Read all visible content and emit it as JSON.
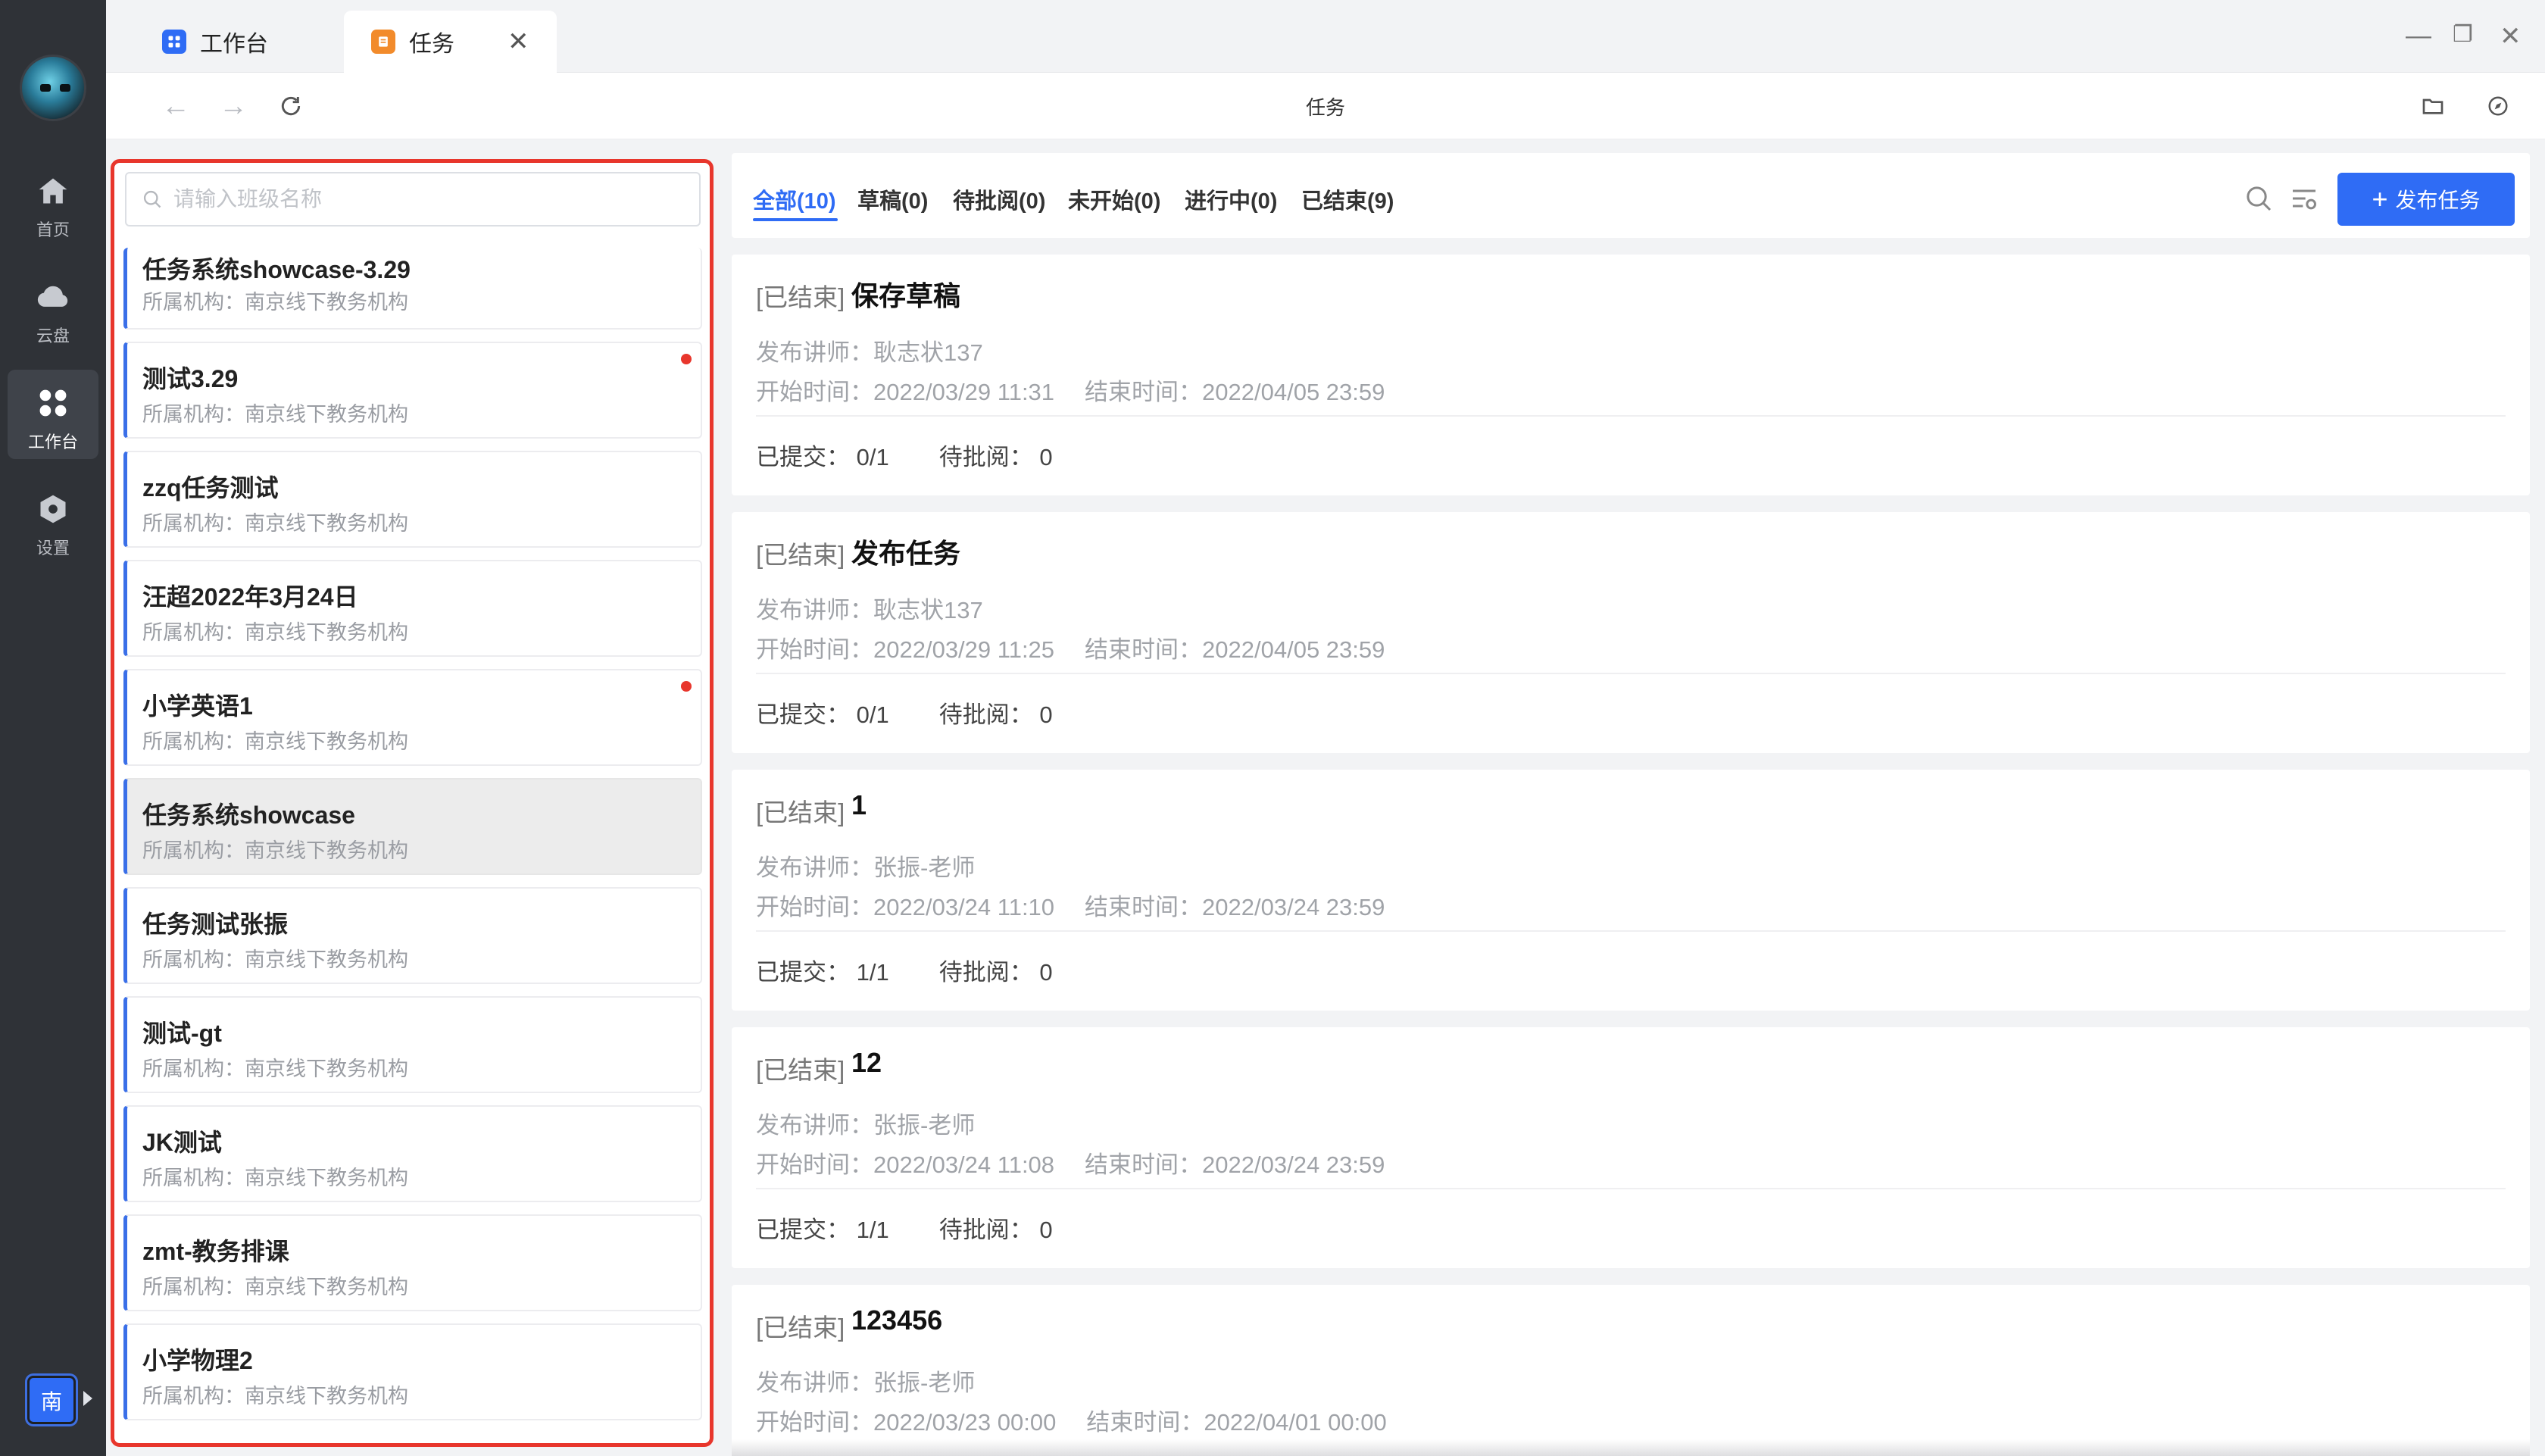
{
  "rail": {
    "nav": [
      {
        "label": "首页",
        "icon": "home-icon"
      },
      {
        "label": "云盘",
        "icon": "cloud-icon"
      },
      {
        "label": "工作台",
        "icon": "workbench-icon"
      },
      {
        "label": "设置",
        "icon": "settings-icon"
      }
    ],
    "org_badge": "南"
  },
  "tabs": [
    {
      "label": "工作台",
      "icon": "workbench-tab-icon",
      "color": "#2f6cf5"
    },
    {
      "label": "任务",
      "icon": "task-tab-icon",
      "color": "#f28b2b"
    }
  ],
  "toolbar": {
    "title": "任务"
  },
  "class_panel": {
    "search_placeholder": "请输入班级名称",
    "org_prefix": "所属机构：",
    "items": [
      {
        "name": "任务系统showcase-3.29",
        "org": "南京线下教务机构",
        "dot": false
      },
      {
        "name": "测试3.29",
        "org": "南京线下教务机构",
        "dot": true
      },
      {
        "name": "zzq任务测试",
        "org": "南京线下教务机构",
        "dot": false
      },
      {
        "name": "汪超2022年3月24日",
        "org": "南京线下教务机构",
        "dot": false
      },
      {
        "name": "小学英语1",
        "org": "南京线下教务机构",
        "dot": true
      },
      {
        "name": "任务系统showcase",
        "org": "南京线下教务机构",
        "dot": false,
        "selected": true
      },
      {
        "name": "任务测试张振",
        "org": "南京线下教务机构",
        "dot": false
      },
      {
        "name": "测试-gt",
        "org": "南京线下教务机构",
        "dot": false
      },
      {
        "name": "JK测试",
        "org": "南京线下教务机构",
        "dot": false
      },
      {
        "name": "zmt-教务排课",
        "org": "南京线下教务机构",
        "dot": false
      },
      {
        "name": "小学物理2",
        "org": "南京线下教务机构",
        "dot": false
      }
    ]
  },
  "filter": {
    "tabs": [
      "全部(10)",
      "草稿(0)",
      "待批阅(0)",
      "未开始(0)",
      "进行中(0)",
      "已结束(9)"
    ],
    "active": 0,
    "publish_label": "发布任务"
  },
  "labels": {
    "teacher": "发布讲师：",
    "start": "开始时间：",
    "end": "结束时间：",
    "submitted": "已提交：",
    "pending": "待批阅："
  },
  "tasks": [
    {
      "status": "[已结束]",
      "title": "保存草稿",
      "teacher": "耿志状137",
      "start": "2022/03/29 11:31",
      "end": "2022/04/05 23:59",
      "submitted": "0/1",
      "pending": "0"
    },
    {
      "status": "[已结束]",
      "title": "发布任务",
      "teacher": "耿志状137",
      "start": "2022/03/29 11:25",
      "end": "2022/04/05 23:59",
      "submitted": "0/1",
      "pending": "0"
    },
    {
      "status": "[已结束]",
      "title": "1",
      "teacher": "张振-老师",
      "start": "2022/03/24 11:10",
      "end": "2022/03/24 23:59",
      "submitted": "1/1",
      "pending": "0"
    },
    {
      "status": "[已结束]",
      "title": "12",
      "teacher": "张振-老师",
      "start": "2022/03/24 11:08",
      "end": "2022/03/24 23:59",
      "submitted": "1/1",
      "pending": "0"
    },
    {
      "status": "[已结束]",
      "title": "123456",
      "teacher": "张振-老师",
      "start": "2022/03/23 00:00",
      "end": "2022/04/01 00:00",
      "submitted": "",
      "pending": ""
    }
  ]
}
